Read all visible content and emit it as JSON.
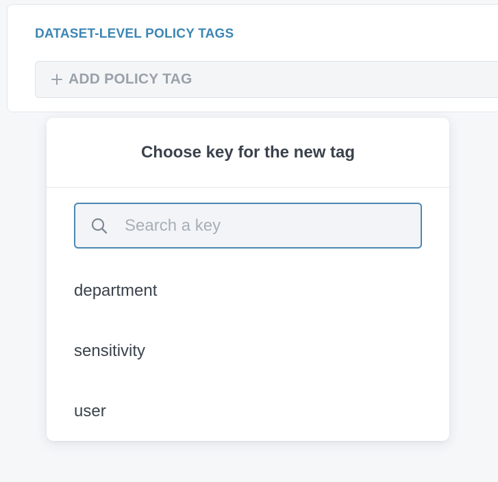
{
  "policy_tags": {
    "section_title": "DATASET-LEVEL POLICY TAGS",
    "add_button_label": "ADD POLICY TAG"
  },
  "key_picker": {
    "title": "Choose key for the new tag",
    "search_placeholder": "Search a key",
    "search_value": "",
    "keys": [
      "department",
      "sensitivity",
      "user"
    ]
  },
  "colors": {
    "accent": "#3c86b4",
    "focus_border": "#4a86b3",
    "muted_text": "#99a1aa",
    "body_text": "#3a424c"
  },
  "icons": {
    "add": "plus-icon",
    "search": "search-icon"
  }
}
